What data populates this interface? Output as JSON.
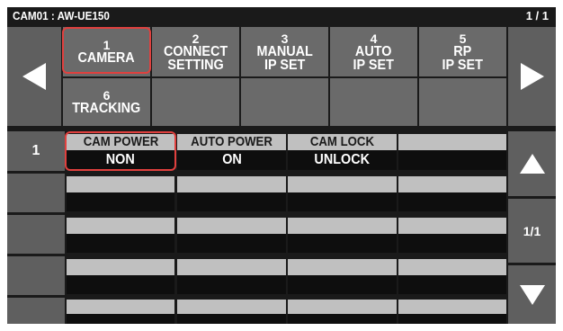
{
  "header": {
    "title": "CAM01 : AW-UE150",
    "page_indicator": "1 / 1"
  },
  "colors": {
    "panel_bg": "#1a1a1a",
    "button_gray": "#5f5f5f",
    "tab_gray": "#6a6a6a",
    "cell_light": "#c0c0c0",
    "cell_dark": "#0e0e0e",
    "highlight": "#e0403e"
  },
  "nav": {
    "prev_icon": "triangle-left-icon",
    "next_icon": "triangle-right-icon"
  },
  "tabs": [
    {
      "num": "1",
      "label": "CAMERA",
      "selected": true
    },
    {
      "num": "2",
      "label": "CONNECT\nSETTING"
    },
    {
      "num": "3",
      "label": "MANUAL\nIP SET"
    },
    {
      "num": "4",
      "label": "AUTO\nIP SET"
    },
    {
      "num": "5",
      "label": "RP\nIP SET"
    },
    {
      "num": "6",
      "label": "TRACKING"
    }
  ],
  "rows": [
    {
      "num": "1",
      "cells": [
        {
          "top": "CAM POWER",
          "bottom": "NON",
          "highlighted": true
        },
        {
          "top": "AUTO POWER",
          "bottom": "ON"
        },
        {
          "top": "CAM LOCK",
          "bottom": "UNLOCK"
        },
        {
          "top": "",
          "bottom": ""
        }
      ]
    },
    {
      "num": "",
      "cells": [
        {
          "top": "",
          "bottom": ""
        },
        {
          "top": "",
          "bottom": ""
        },
        {
          "top": "",
          "bottom": ""
        },
        {
          "top": "",
          "bottom": ""
        }
      ]
    },
    {
      "num": "",
      "cells": [
        {
          "top": "",
          "bottom": ""
        },
        {
          "top": "",
          "bottom": ""
        },
        {
          "top": "",
          "bottom": ""
        },
        {
          "top": "",
          "bottom": ""
        }
      ]
    },
    {
      "num": "",
      "cells": [
        {
          "top": "",
          "bottom": ""
        },
        {
          "top": "",
          "bottom": ""
        },
        {
          "top": "",
          "bottom": ""
        },
        {
          "top": "",
          "bottom": ""
        }
      ]
    },
    {
      "num": "",
      "cells": [
        {
          "top": "",
          "bottom": ""
        },
        {
          "top": "",
          "bottom": ""
        },
        {
          "top": "",
          "bottom": ""
        },
        {
          "top": "",
          "bottom": ""
        }
      ]
    }
  ],
  "side": {
    "up_icon": "triangle-up-icon",
    "page_label": "1/1",
    "down_icon": "triangle-down-icon"
  }
}
